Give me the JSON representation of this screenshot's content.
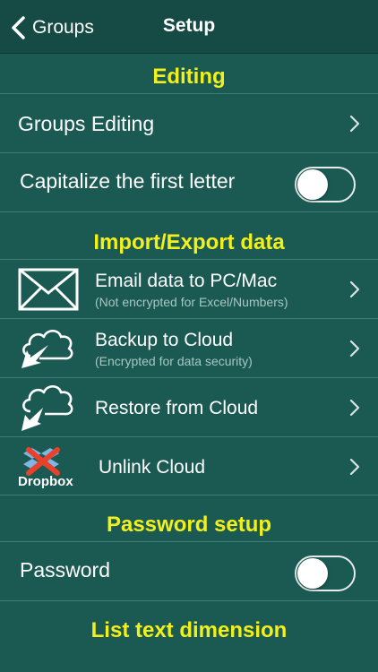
{
  "navbar": {
    "back_label": "Groups",
    "title": "Setup"
  },
  "sections": {
    "editing": "Editing",
    "import_export": "Import/Export data",
    "password_setup": "Password setup",
    "list_text_dimension": "List text dimension"
  },
  "rows": {
    "groups_editing": {
      "label": "Groups Editing"
    },
    "capitalize": {
      "label": "Capitalize the first letter",
      "enabled": false
    },
    "email": {
      "label": "Email data to PC/Mac",
      "sublabel": "(Not encrypted for Excel/Numbers)"
    },
    "backup": {
      "label": "Backup to Cloud",
      "sublabel": "(Encrypted for data security)"
    },
    "restore": {
      "label": "Restore from Cloud"
    },
    "unlink": {
      "label": "Unlink Cloud",
      "icon_text": "Dropbox"
    },
    "password": {
      "label": "Password",
      "enabled": false
    }
  },
  "colors": {
    "background": "#1a5a53",
    "navbar": "#154a45",
    "section_header": "#f2f01c",
    "separator": "#3f7d76",
    "sublabel": "#a9c6c2",
    "unlink_cross": "#e8412c"
  },
  "icons": {
    "back": "chevron-left-icon",
    "row_disclosure": "chevron-right-icon",
    "email": "envelope-icon",
    "backup": "cloud-upload-icon",
    "restore": "cloud-download-icon",
    "unlink": "dropbox-unlink-icon"
  }
}
